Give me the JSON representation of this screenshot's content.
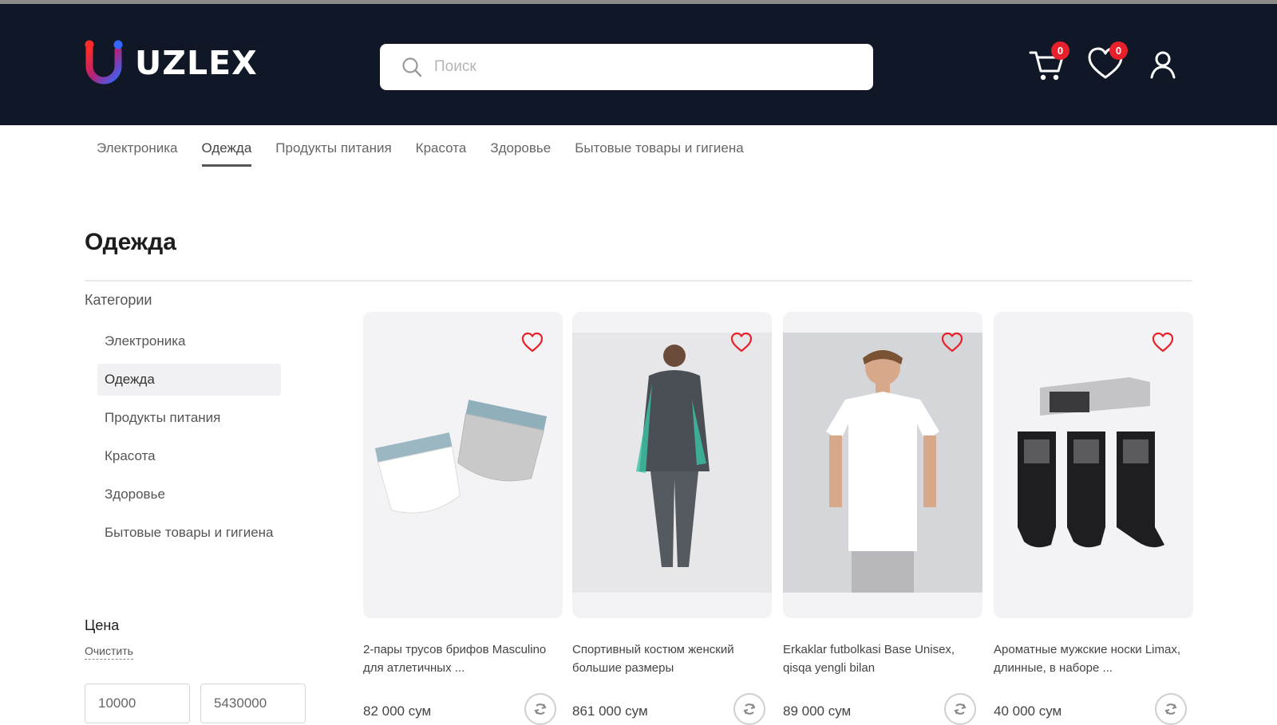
{
  "brand": {
    "name": "UZLEX",
    "accent": "#e8202c",
    "header_bg": "#101828"
  },
  "search": {
    "placeholder": "Поиск",
    "icon": "search-icon"
  },
  "header_icons": {
    "cart_count": "0",
    "wishlist_count": "0"
  },
  "nav": {
    "items": [
      {
        "label": "Электроника"
      },
      {
        "label": "Одежда"
      },
      {
        "label": "Продукты питания"
      },
      {
        "label": "Красота"
      },
      {
        "label": "Здоровье"
      },
      {
        "label": "Бытовые товары и гигиена"
      }
    ],
    "active": "Одежда"
  },
  "page": {
    "title": "Одежда"
  },
  "sidebar": {
    "title": "Категории",
    "items": [
      {
        "label": "Электроника"
      },
      {
        "label": "Одежда"
      },
      {
        "label": "Продукты питания"
      },
      {
        "label": "Красота"
      },
      {
        "label": "Здоровье"
      },
      {
        "label": "Бытовые товары и гигиена"
      }
    ],
    "active": "Одежда"
  },
  "price_filter": {
    "title": "Цена",
    "clear_label": "Очистить",
    "min": "10000",
    "max": "5430000"
  },
  "products": [
    {
      "title": "2-пары трусов брифов Masculino для атлетичных ...",
      "price": "82 000 сум"
    },
    {
      "title": "Спортивный костюм женский большие размеры",
      "price": "861 000 сум"
    },
    {
      "title": "Erkaklar futbolkasi Base Unisex, qisqa yengli bilan",
      "price": "89 000 сум"
    },
    {
      "title": "Ароматные мужские носки Limax, длинные, в наборе ...",
      "price": "40 000 сум"
    }
  ]
}
